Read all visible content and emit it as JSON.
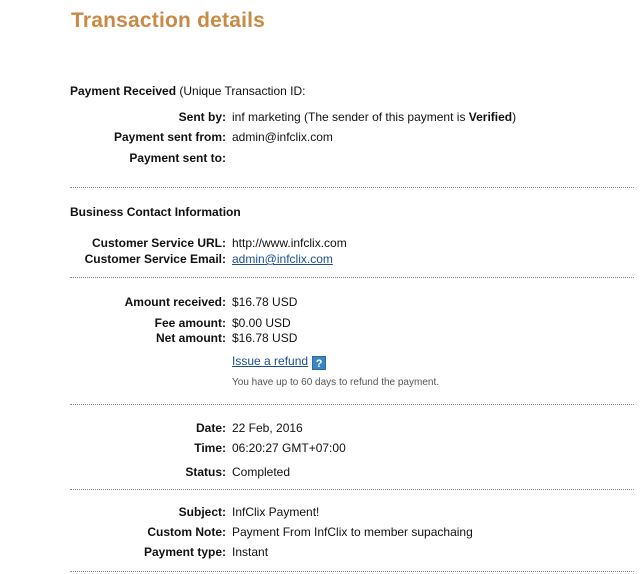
{
  "page_title": "Transaction details",
  "payment_section": {
    "heading_bold": "Payment Received",
    "heading_rest": " (Unique Transaction ID:",
    "sent_by_label": "Sent by:",
    "sent_by_value_pre": "inf marketing (The sender of this payment is ",
    "sent_by_value_bold": "Verified",
    "sent_by_value_post": ")",
    "sent_from_label": "Payment sent from:",
    "sent_from_value": "admin@infclix.com",
    "sent_to_label": "Payment sent to:",
    "sent_to_value": ""
  },
  "contact_section": {
    "heading": "Business Contact Information",
    "url_label": "Customer Service URL:",
    "url_value": "http://www.infclix.com",
    "email_label": "Customer Service Email:",
    "email_value": "admin@infclix.com"
  },
  "amount_section": {
    "received_label": "Amount received:",
    "received_value": "$16.78 USD",
    "fee_label": "Fee amount:",
    "fee_value": "$0.00 USD",
    "net_label": "Net amount:",
    "net_value": "$16.78 USD",
    "refund_link": "Issue a refund",
    "help_icon_glyph": "?",
    "refund_note": "You have up to 60 days to refund the payment."
  },
  "date_section": {
    "date_label": "Date:",
    "date_value": "22 Feb, 2016",
    "time_label": "Time:",
    "time_value": "06:20:27 GMT+07:00",
    "status_label": "Status:",
    "status_value": "Completed"
  },
  "details_section": {
    "subject_label": "Subject:",
    "subject_value": "InfClix Payment!",
    "note_label": "Custom Note:",
    "note_value": "Payment From InfClix to member supachaing",
    "type_label": "Payment type:",
    "type_value": "Instant"
  },
  "colors": {
    "title": "#c88a44",
    "link": "#1a4f8f",
    "help_icon_bg": "#3d86c6"
  }
}
